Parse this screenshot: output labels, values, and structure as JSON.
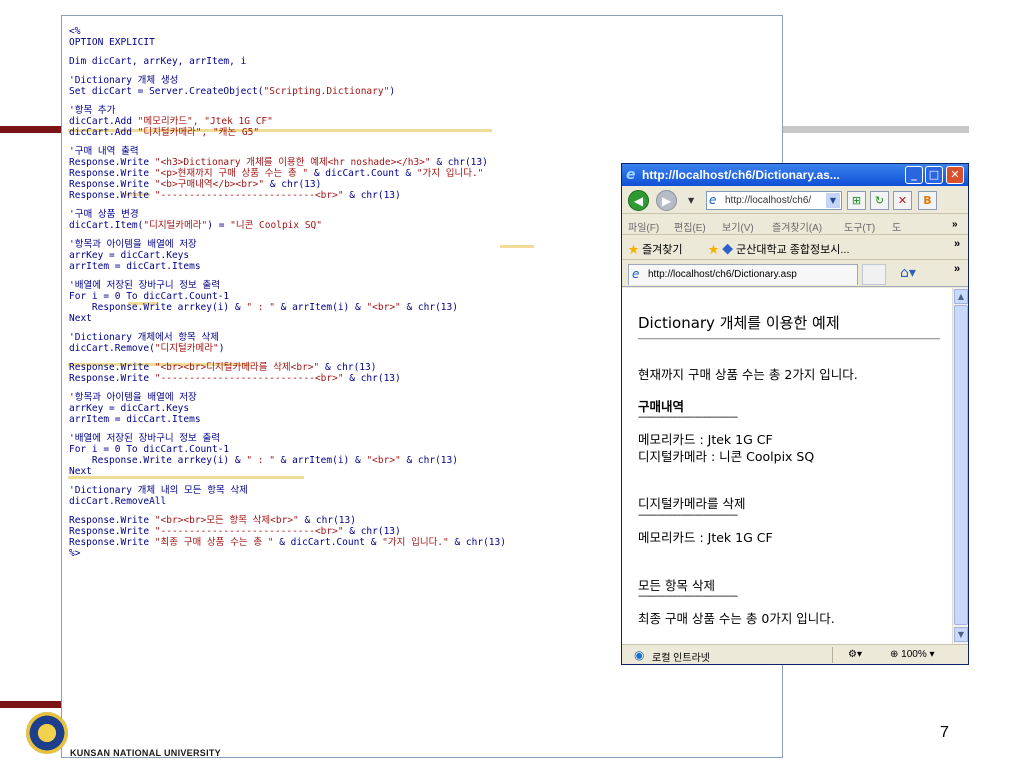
{
  "slide": {
    "page_number": "7",
    "university": "KUNSAN NATIONAL UNIVERSITY"
  },
  "code": {
    "lines": [
      [
        {
          "t": "<%",
          "c": "kw"
        }
      ],
      [
        {
          "t": "OPTION EXPLICIT",
          "c": "kw"
        }
      ],
      [],
      [
        {
          "t": "Dim dicCart, arrKey, arrItem, i",
          "c": "kw"
        }
      ],
      [],
      [
        {
          "t": "'Dictionary 개체 생성",
          "c": "cmt"
        }
      ],
      [
        {
          "t": "Set dicCart = Server.CreateObject(",
          "c": "kw"
        },
        {
          "t": "\"Scripting.Dictionary\"",
          "c": "str"
        },
        {
          "t": ")",
          "c": "kw"
        }
      ],
      [],
      [
        {
          "t": "'항목 추가",
          "c": "cmt"
        }
      ],
      [
        {
          "t": "dicCart.Add ",
          "c": "kw"
        },
        {
          "t": "\"메모리카드\", \"Jtek 1G CF\"",
          "c": "str"
        }
      ],
      [
        {
          "t": "dicCart.Add ",
          "c": "kw"
        },
        {
          "t": "\"디지털카메라\", \"캐논 G5\"",
          "c": "str"
        }
      ],
      [],
      [
        {
          "t": "'구매 내역 출력",
          "c": "cmt"
        }
      ],
      [
        {
          "t": "Response.Write ",
          "c": "kw"
        },
        {
          "t": "\"<h3>Dictionary 개체를 이용한 예제<hr noshade></h3>\"",
          "c": "str"
        },
        {
          "t": " & chr(13)",
          "c": "kw"
        }
      ],
      [
        {
          "t": "Response.Write ",
          "c": "kw"
        },
        {
          "t": "\"<p>현재까지 구매 상품 수는 총 \"",
          "c": "str"
        },
        {
          "t": " & dicCart.Count & ",
          "c": "kw"
        },
        {
          "t": "\"가지 입니다.\"",
          "c": "str"
        }
      ],
      [
        {
          "t": "Response.Write ",
          "c": "kw"
        },
        {
          "t": "\"<b>구매내역</b><br>\"",
          "c": "str"
        },
        {
          "t": " & chr(13)",
          "c": "kw"
        }
      ],
      [
        {
          "t": "Response.Write ",
          "c": "kw"
        },
        {
          "t": "\"---------------------------<br>\"",
          "c": "str"
        },
        {
          "t": " & chr(13)",
          "c": "kw"
        }
      ],
      [],
      [
        {
          "t": "'구매 상품 변경",
          "c": "cmt"
        }
      ],
      [
        {
          "t": "dicCart.Item(",
          "c": "kw"
        },
        {
          "t": "\"디지털카메라\"",
          "c": "str"
        },
        {
          "t": ") = ",
          "c": "kw"
        },
        {
          "t": "\"니콘 Coolpix SQ\"",
          "c": "str"
        }
      ],
      [],
      [
        {
          "t": "'항목과 아이템을 배열에 저장",
          "c": "cmt"
        }
      ],
      [
        {
          "t": "arrKey = dicCart.Keys",
          "c": "kw"
        }
      ],
      [
        {
          "t": "arrItem = dicCart.Items",
          "c": "kw"
        }
      ],
      [],
      [
        {
          "t": "'배열에 저장된 장바구니 정보 출력",
          "c": "cmt"
        }
      ],
      [
        {
          "t": "For i = 0 To dicCart.Count-1",
          "c": "kw"
        }
      ],
      [
        {
          "t": "    Response.Write arrkey(i) & ",
          "c": "kw"
        },
        {
          "t": "\" : \"",
          "c": "str"
        },
        {
          "t": " & arrItem(i) & ",
          "c": "kw"
        },
        {
          "t": "\"<br>\"",
          "c": "str"
        },
        {
          "t": " & chr(13)",
          "c": "kw"
        }
      ],
      [
        {
          "t": "Next",
          "c": "kw"
        }
      ],
      [],
      [
        {
          "t": "'Dictionary 개체에서 항목 삭제",
          "c": "cmt"
        }
      ],
      [
        {
          "t": "dicCart.Remove(",
          "c": "kw"
        },
        {
          "t": "\"디지털카메라\"",
          "c": "str"
        },
        {
          "t": ")",
          "c": "kw"
        }
      ],
      [],
      [
        {
          "t": "Response.Write ",
          "c": "kw"
        },
        {
          "t": "\"<br><br>디지털카메라를 삭제<br>\"",
          "c": "str"
        },
        {
          "t": " & chr(13)",
          "c": "kw"
        }
      ],
      [
        {
          "t": "Response.Write ",
          "c": "kw"
        },
        {
          "t": "\"---------------------------<br>\"",
          "c": "str"
        },
        {
          "t": " & chr(13)",
          "c": "kw"
        }
      ],
      [],
      [
        {
          "t": "'항목과 아이템을 배열에 저장",
          "c": "cmt"
        }
      ],
      [
        {
          "t": "arrKey = dicCart.Keys",
          "c": "kw"
        }
      ],
      [
        {
          "t": "arrItem = dicCart.Items",
          "c": "kw"
        }
      ],
      [],
      [
        {
          "t": "'배열에 저장된 장바구니 정보 출력",
          "c": "cmt"
        }
      ],
      [
        {
          "t": "For i = 0 To dicCart.Count-1",
          "c": "kw"
        }
      ],
      [
        {
          "t": "    Response.Write arrkey(i) & ",
          "c": "kw"
        },
        {
          "t": "\" : \"",
          "c": "str"
        },
        {
          "t": " & arrItem(i) & ",
          "c": "kw"
        },
        {
          "t": "\"<br>\"",
          "c": "str"
        },
        {
          "t": " & chr(13)",
          "c": "kw"
        }
      ],
      [
        {
          "t": "Next",
          "c": "kw"
        }
      ],
      [],
      [
        {
          "t": "'Dictionary 개체 내의 모든 항목 삭제",
          "c": "cmt"
        }
      ],
      [
        {
          "t": "dicCart.RemoveAll",
          "c": "kw"
        }
      ],
      [],
      [
        {
          "t": "Response.Write ",
          "c": "kw"
        },
        {
          "t": "\"<br><br>모든 항목 삭제<br>\"",
          "c": "str"
        },
        {
          "t": " & chr(13)",
          "c": "kw"
        }
      ],
      [
        {
          "t": "Response.Write ",
          "c": "kw"
        },
        {
          "t": "\"---------------------------<br>\"",
          "c": "str"
        },
        {
          "t": " & chr(13)",
          "c": "kw"
        }
      ],
      [
        {
          "t": "Response.Write ",
          "c": "kw"
        },
        {
          "t": "\"최종 구매 상품 수는 총 \"",
          "c": "str"
        },
        {
          "t": " & dicCart.Count & ",
          "c": "kw"
        },
        {
          "t": "\"가지 입니다.\"",
          "c": "str"
        },
        {
          "t": " & chr(13)",
          "c": "kw"
        }
      ],
      [
        {
          "t": "%>",
          "c": "kw"
        }
      ]
    ]
  },
  "browser": {
    "title": "http://localhost/ch6/Dictionary.as...",
    "address": "http://localhost/ch6/",
    "menu": [
      "파일(F)",
      "편집(E)",
      "보기(V)",
      "즐겨찾기(A)",
      "도구(T)",
      "도"
    ],
    "favorites": [
      "즐겨찾기",
      "군산대학교 종합정보시..."
    ],
    "tab_title": "http://localhost/ch6/Dictionary.asp",
    "page": {
      "heading": "Dictionary 개체를 이용한 예제",
      "count_line": "현재까지 구매 상품 수는 총 2가지 입니다.",
      "list_title": "구매내역",
      "dashes": "--------------------------------------",
      "item1": "메모리카드 : Jtek 1G CF",
      "item2": "디지털카메라 : 니콘 Coolpix SQ",
      "deleted_title": "디지털카메라를 삭제",
      "remaining_item": "메모리카드 : Jtek 1G CF",
      "all_deleted": "모든 항목 삭제",
      "final_line": "최종 구매 상품 수는 총 0가지 입니다."
    },
    "status": {
      "zone": "로컬 인트라넷",
      "zoom": "100%"
    }
  },
  "colors": {
    "code_keyword": "#00008b",
    "code_string": "#a31515",
    "highlight": "#f0dc96",
    "accent_line": "#7b1414"
  }
}
